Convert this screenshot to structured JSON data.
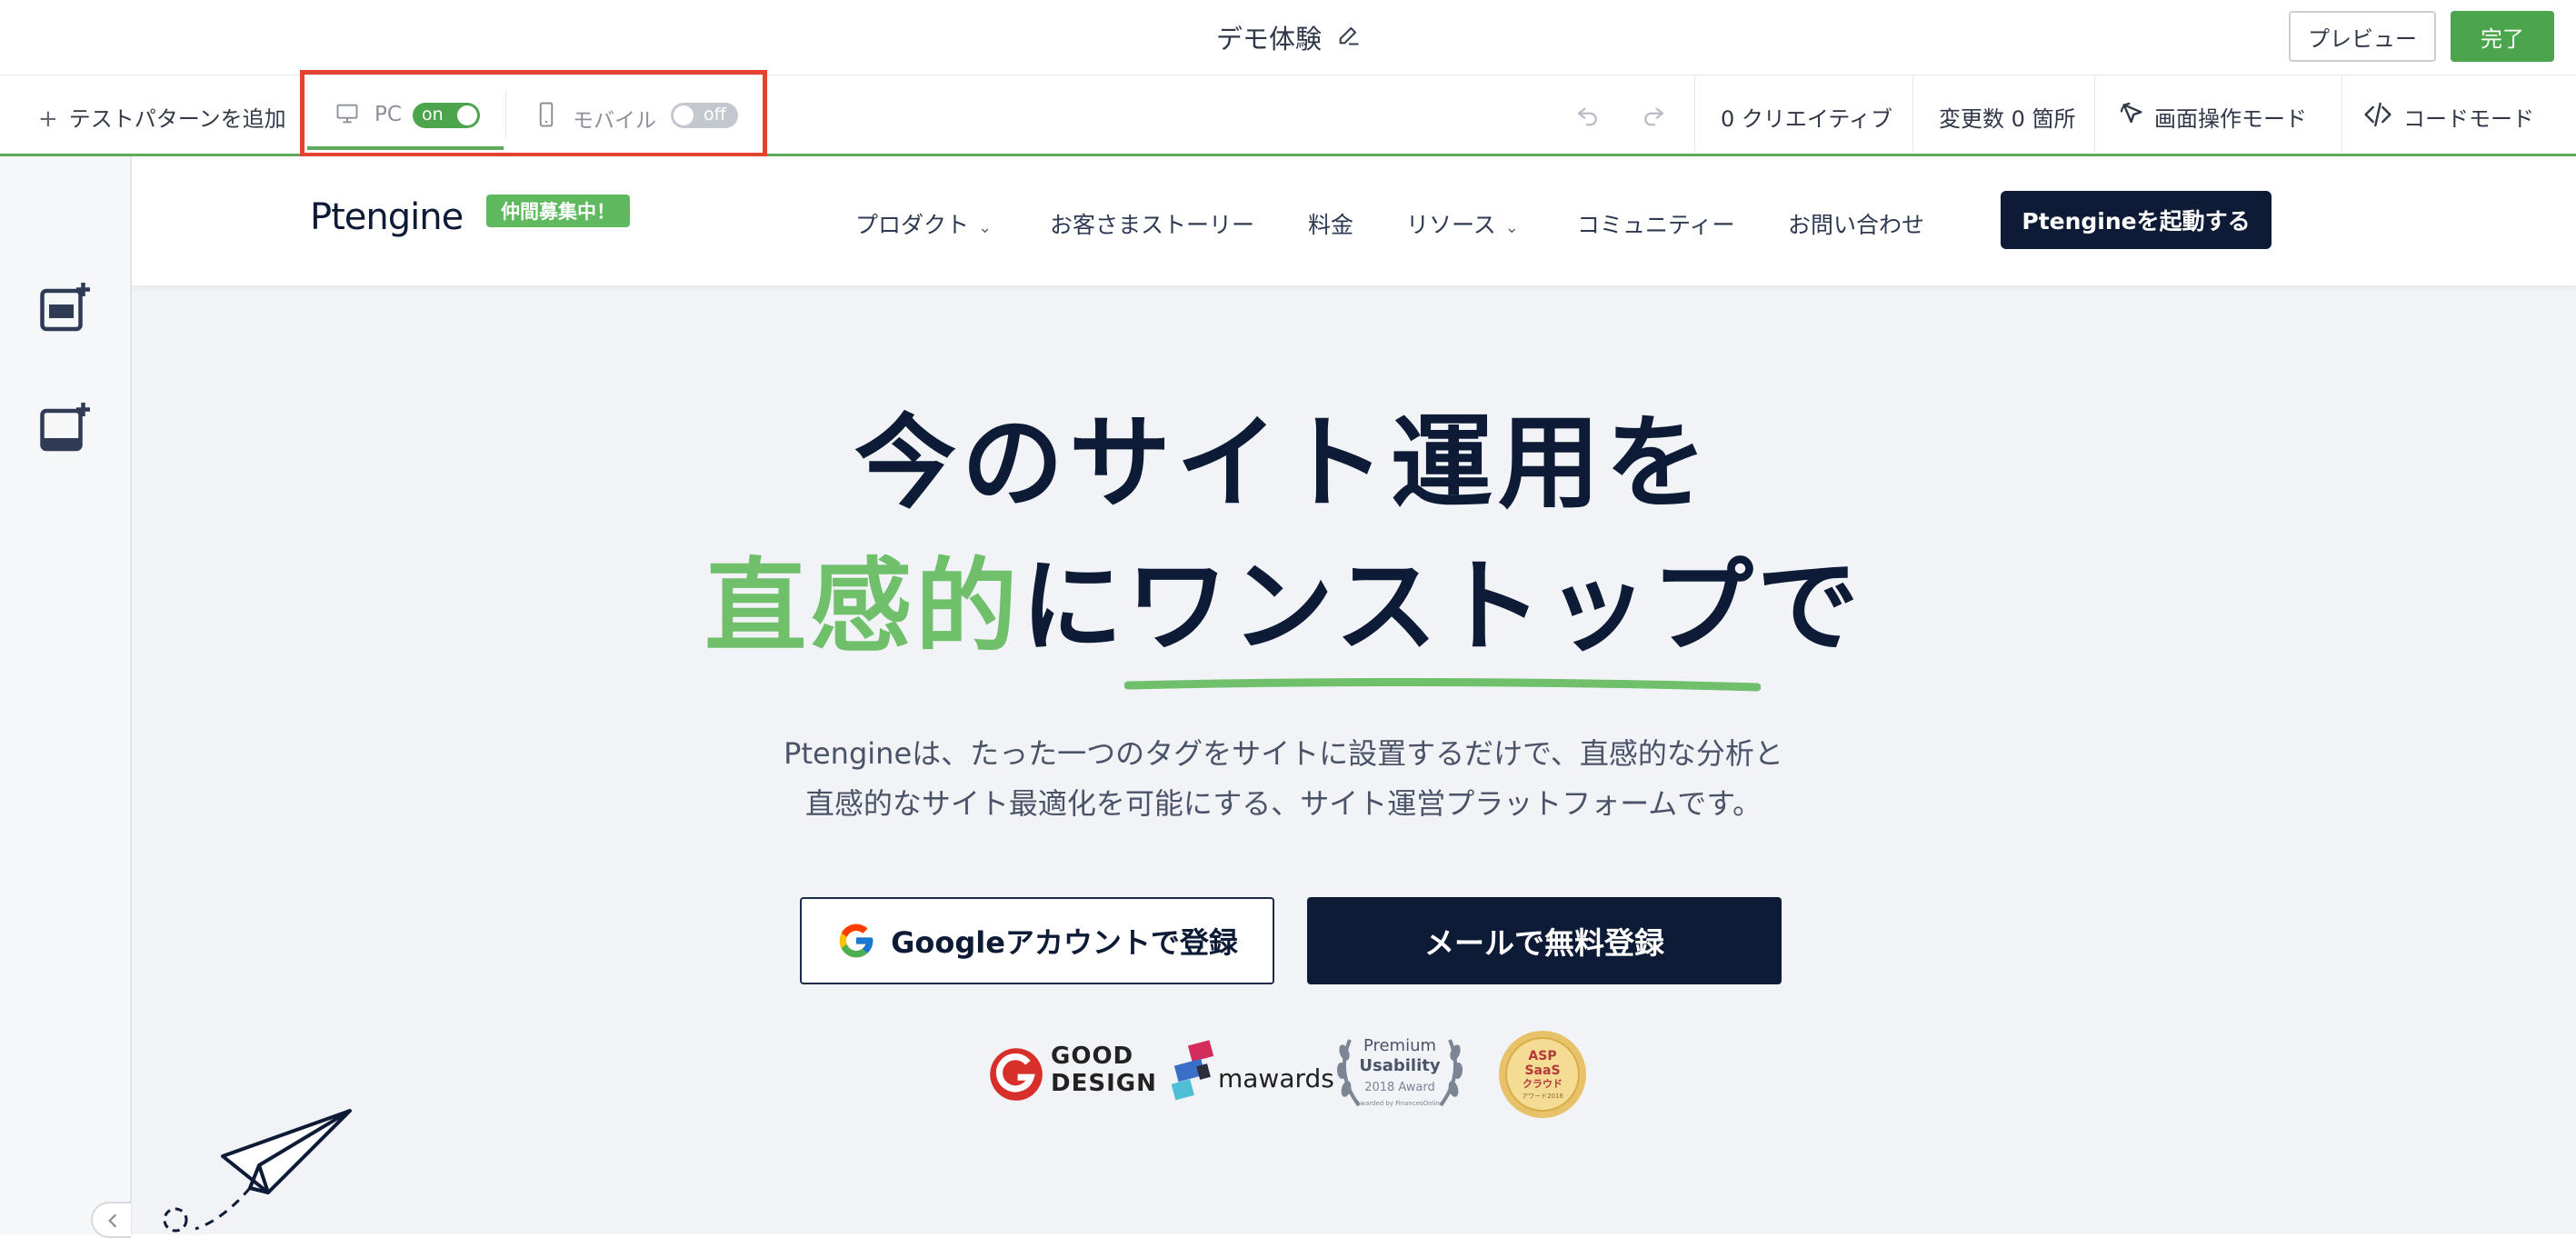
{
  "editor": {
    "title": "デモ体験",
    "preview_label": "プレビュー",
    "done_label": "完了",
    "add_pattern_label": "テストパターンを追加",
    "pc_tab": {
      "label": "PC",
      "toggle": "on"
    },
    "mobile_tab": {
      "label": "モバイル",
      "toggle": "off"
    },
    "creatives_label": "0 クリエイティブ",
    "changes_label": "変更数 0 箇所",
    "screen_mode_label": "画面操作モード",
    "code_mode_label": "コードモード",
    "accent_color": "#4ca44d",
    "highlight_color": "#e5432f"
  },
  "site": {
    "logo": "Ptengine",
    "hiring_badge": "仲間募集中！",
    "nav": [
      {
        "label": "プロダクト",
        "dropdown": true
      },
      {
        "label": "お客さまストーリー",
        "dropdown": false
      },
      {
        "label": "料金",
        "dropdown": false
      },
      {
        "label": "リソース",
        "dropdown": true
      },
      {
        "label": "コミュニティー",
        "dropdown": false
      },
      {
        "label": "お問い合わせ",
        "dropdown": false
      }
    ],
    "nav_cta": "Ptengineを起動する",
    "hero_line1": "今のサイト運用を",
    "hero_line2_green": "直感的",
    "hero_line2_ni": "に",
    "hero_line2_navy": "ワンストップ",
    "hero_line2_de": "で",
    "sub_line1": "Ptengineは、たった一つのタグをサイトに設置するだけで、直感的な分析と",
    "sub_line2": "直感的なサイト最適化を可能にする、サイト運営プラットフォームです。",
    "google_button": "Googleアカウントで登録",
    "mail_button": "メールで無料登録",
    "awards": {
      "good_design_1": "GOOD",
      "good_design_2": "DESIGN",
      "mawards": "mawards",
      "premium_1": "Premium",
      "premium_2": "Usability",
      "premium_3": "2018 Award",
      "premium_4": "Awarded by FinancesOnline",
      "asp_1": "ASP",
      "asp_2": "SaaS",
      "asp_3": "クラウド",
      "asp_4": "アワード2016"
    },
    "brand_navy": "#0e1b36",
    "brand_green": "#6fbf6b"
  }
}
